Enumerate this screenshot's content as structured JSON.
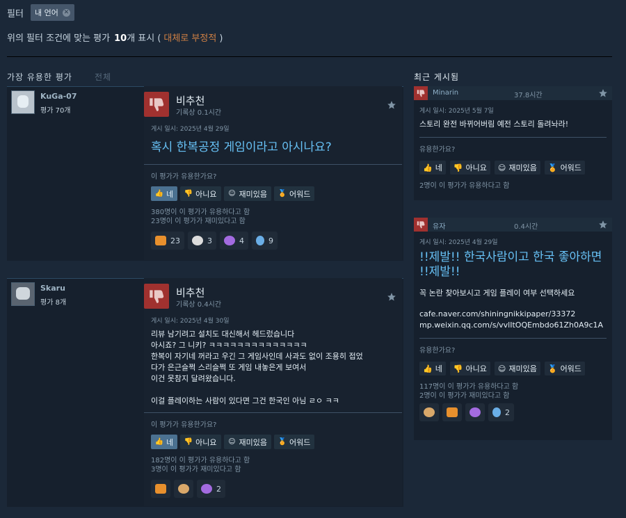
{
  "filter": {
    "label": "필터",
    "chip_label": "내 언어",
    "chip_close": "✕"
  },
  "summary": {
    "prefix": "위의 필터 조건에 맞는 평가",
    "count": "10",
    "suffix": "개 표시 (",
    "sentiment": "대체로 부정적",
    "close": ")"
  },
  "tabs": {
    "most_helpful": "가장 유용한 평가",
    "all": "전체"
  },
  "recent_title": "최근 게시됨",
  "colors": {
    "background": "#1b2838",
    "negative_red": "#a0312f",
    "link_blue": "#67c1f5",
    "sentiment_orange": "#d08044"
  },
  "reviews": [
    {
      "username": "KuGa-07",
      "user_reviews": "평가 70개",
      "verdict": "비추천",
      "hours": "기록상 0.1시간",
      "posted": "게시 일시: 2025년 4월 29일",
      "title": "혹시 한복공정 게임이라고 아시나요?",
      "helpful_q": "이 평가가 유용한가요?",
      "buttons": {
        "yes": "네",
        "no": "아니요",
        "funny": "재미있음",
        "award": "어워드"
      },
      "count_helpful": "380명이 이 평가가 유용하다고 함",
      "count_funny": "23명이 이 평가가 재미있다고 함",
      "awards": [
        "23",
        "3",
        "4",
        "9"
      ]
    },
    {
      "username": "Skaru",
      "user_reviews": "평가 8개",
      "verdict": "비추천",
      "hours": "기록상 0.4시간",
      "posted": "게시 일시: 2025년 4월 30일",
      "text": "리뷰 남기려고 설치도 대신해서 헤드렀습니다\n아시죠? 그 니키? ㅋㅋㅋㅋㅋㅋㅋㅋㅋㅋㅋㅋㅋㅋ\n한복이 자기네 꺼라고 우긴 그 게임사인데 사과도 없이 조용히 접었\n다가 은근슬쩍 스리슬쩍 또 게임 내놓은게 보여서\n이건 못참지 달려왔습니다.\n\n이걸 플레이하는 사람이 있다면 그건 한국인 아님 ㄹㅇ ㅋㅋ",
      "helpful_q": "이 평가가 유용한가요?",
      "buttons": {
        "yes": "네",
        "no": "아니요",
        "funny": "재미있음",
        "award": "어워드"
      },
      "count_helpful": "182명이 이 평가가 유용하다고 함",
      "count_funny": "3명이 이 평가가 재미있다고 함",
      "awards": [
        "2"
      ]
    }
  ],
  "recent": [
    {
      "username": "Minarin",
      "hours": "37.8시간",
      "posted": "게시 일시: 2025년 5월 7일",
      "text": "스토리 완전 바뀌어버림 예전 스토리 돌려놔라!",
      "helpful_q": "유용한가요?",
      "buttons": {
        "yes": "네",
        "no": "아니요",
        "funny": "재미있음",
        "award": "어워드"
      },
      "count_helpful": "2명이 이 평가가 유용하다고 함"
    },
    {
      "username": "유자",
      "hours": "0.4시간",
      "posted": "게시 일시: 2025년 4월 29일",
      "title": "!!제발!! 한국사람이고 한국 좋아하면 !!제발!!",
      "text": "꼭 논란 찾아보시고 게임 플레이 여부 선택하세요",
      "link1": "cafe.naver.com/shiningnikkipaper/33372",
      "link2": "mp.weixin.qq.com/s/vvlItOQEmbdo61Zh0A9c1A",
      "helpful_q": "유용한가요?",
      "buttons": {
        "yes": "네",
        "no": "아니요",
        "funny": "재미있음",
        "award": "어워드"
      },
      "count_helpful": "117명이 이 평가가 유용하다고 함",
      "count_funny": "2명이 이 평가가 재미있다고 함",
      "awards": [
        "2"
      ]
    }
  ]
}
